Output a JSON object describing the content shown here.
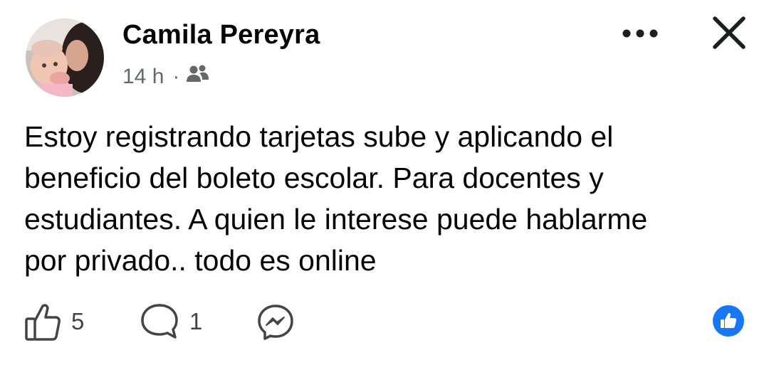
{
  "post": {
    "author": "Camila Pereyra",
    "time": "14 h",
    "separator": "·",
    "audience_icon": "friends-icon",
    "text": "Estoy registrando tarjetas sube y aplicando el\nbeneficio del boleto escolar. Para docentes y\nestudiantes. A quien le interese puede hablarme\npor privado.. todo es online"
  },
  "header": {
    "more_icon": "more-options-icon",
    "close_icon": "close-icon"
  },
  "actions": {
    "like_count": "5",
    "comment_count": "1",
    "share_icon": "messenger-icon",
    "reaction_icon": "like-reaction-icon"
  },
  "colors": {
    "text": "#050505",
    "secondary": "#65676b",
    "reaction_blue": "#1877f2"
  }
}
